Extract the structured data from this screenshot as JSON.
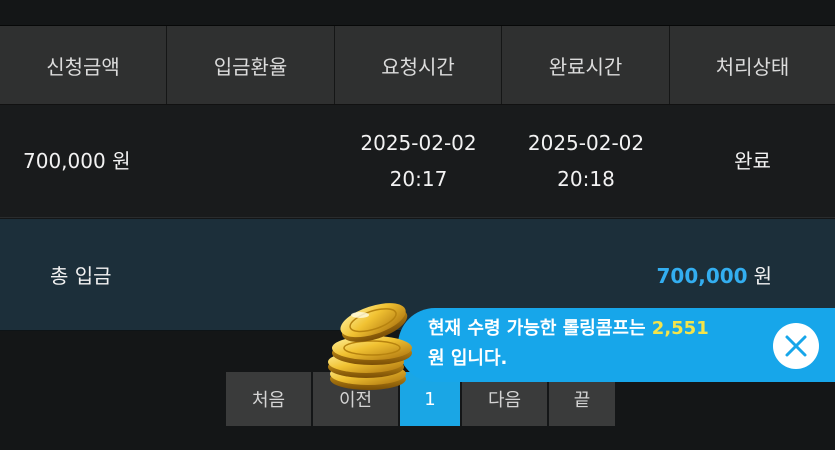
{
  "table": {
    "headers": [
      "신청금액",
      "입금환율",
      "요청시간",
      "완료시간",
      "처리상태"
    ],
    "rows": [
      {
        "amount": "700,000 원",
        "rate": "",
        "request_date": "2025-02-02",
        "request_time": "20:17",
        "complete_date": "2025-02-02",
        "complete_time": "20:18",
        "status": "완료"
      }
    ]
  },
  "total": {
    "label": "총 입금",
    "amount": "700,000",
    "unit": "원"
  },
  "toast": {
    "text_before": "현재 수령 가능한 롤링콤프는 ",
    "points": "2,551",
    "text_after": "원 입니다."
  },
  "pagination": {
    "first": "처음",
    "prev": "이전",
    "current": "1",
    "next": "다음",
    "last": "끝"
  },
  "colors": {
    "accent": "#1aa6e5",
    "status_done": "#5bd15a",
    "points": "#f4e44a"
  }
}
